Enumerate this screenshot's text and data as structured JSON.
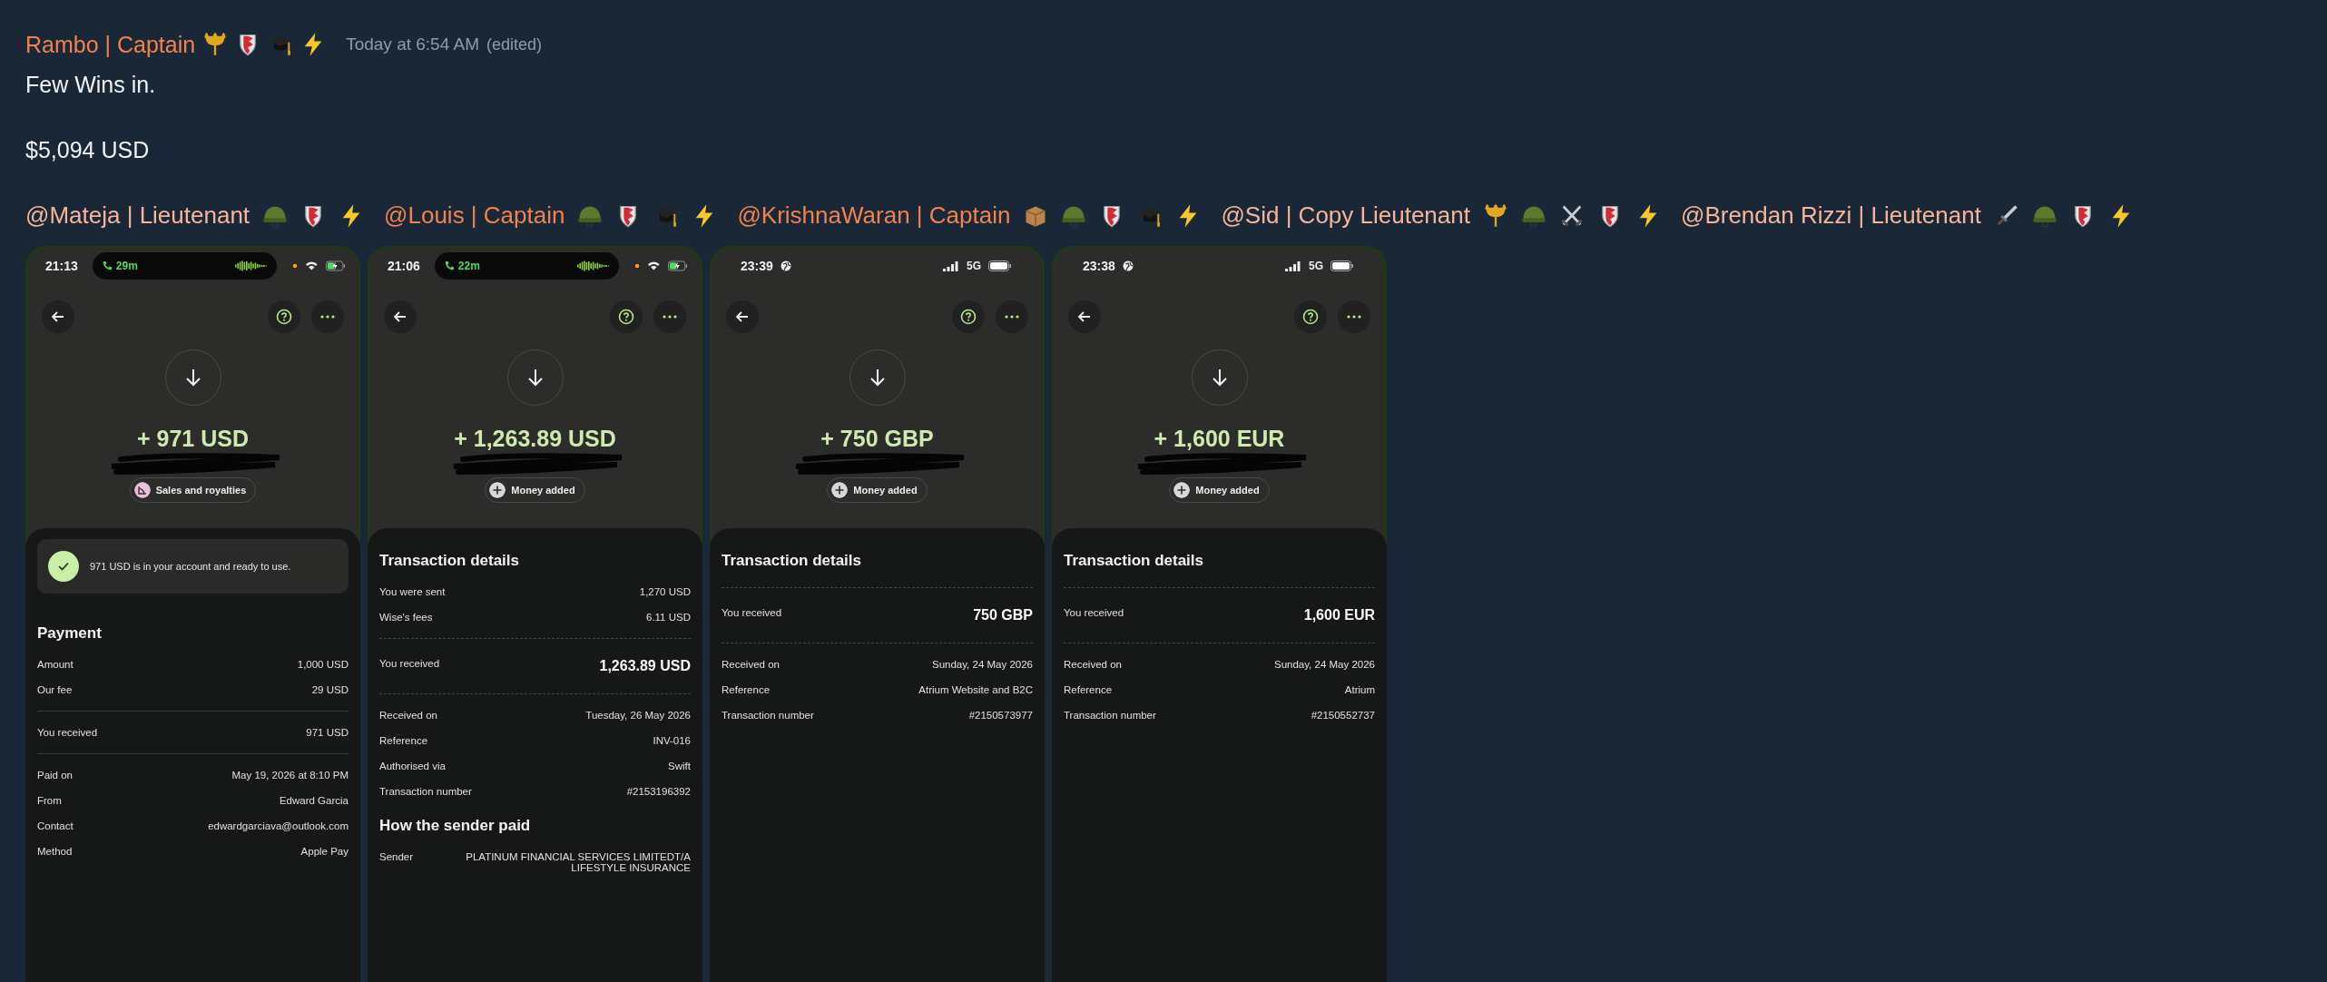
{
  "message": {
    "author": {
      "name": "Rambo | Captain",
      "color": "#f0834f",
      "badges": [
        {
          "kind": "trident"
        },
        {
          "kind": "shield"
        },
        {
          "kind": "cap"
        },
        {
          "kind": "bolt"
        }
      ]
    },
    "timestamp": "Today at 6:54 AM",
    "edited": "(edited)",
    "lines": [
      "Few Wins in.",
      "$5,094 USD"
    ],
    "mentions": [
      {
        "text": "@Mateja | Lieutenant",
        "color": "#f6b59a",
        "badges": [
          {
            "kind": "helmet"
          },
          {
            "kind": "shield"
          },
          {
            "kind": "bolt"
          }
        ]
      },
      {
        "text": "@Louis | Captain",
        "color": "#f0834f",
        "badges": [
          {
            "kind": "helmet"
          },
          {
            "kind": "shield"
          },
          {
            "kind": "cap"
          },
          {
            "kind": "bolt"
          }
        ]
      },
      {
        "text": "@KrishnaWaran | Captain",
        "color": "#f0834f",
        "badges": [
          {
            "kind": "box"
          },
          {
            "kind": "helmet"
          },
          {
            "kind": "shield"
          },
          {
            "kind": "cap"
          },
          {
            "kind": "bolt"
          }
        ]
      },
      {
        "text": "@Sid | Copy Lieutenant",
        "color": "#f6b59a",
        "badges": [
          {
            "kind": "trident"
          },
          {
            "kind": "helmet"
          },
          {
            "kind": "swords"
          },
          {
            "kind": "shield"
          },
          {
            "kind": "bolt"
          }
        ]
      },
      {
        "text": "@Brendan Rizzi | Lieutenant",
        "color": "#f6b59a",
        "badges": [
          {
            "kind": "dagger"
          },
          {
            "kind": "helmet"
          },
          {
            "kind": "shield"
          },
          {
            "kind": "bolt"
          }
        ]
      }
    ],
    "attachments": [
      {
        "status": {
          "kind": "call",
          "time": "21:13",
          "call_duration": "29m"
        },
        "amount": "+ 971 USD",
        "chip": {
          "kind": "sales",
          "label": "Sales and royalties"
        },
        "sheet": [
          {
            "kind": "notice",
            "text": "971 USD is in your account and ready to use."
          },
          {
            "kind": "heading",
            "text": "Payment"
          },
          {
            "kind": "row",
            "label": "Amount",
            "value": "1,000 USD"
          },
          {
            "kind": "row",
            "label": "Our fee",
            "value": "29 USD"
          },
          {
            "kind": "divider"
          },
          {
            "kind": "row",
            "label": "You received",
            "value": "971 USD"
          },
          {
            "kind": "divider"
          },
          {
            "kind": "row",
            "label": "Paid on",
            "value": "May 19, 2026 at 8:10 PM"
          },
          {
            "kind": "row",
            "label": "From",
            "value": "Edward Garcia"
          },
          {
            "kind": "row",
            "label": "Contact",
            "value": "edwardgarciava@outlook.com"
          },
          {
            "kind": "row",
            "label": "Method",
            "value": "Apple Pay"
          }
        ]
      },
      {
        "status": {
          "kind": "call",
          "time": "21:06",
          "call_duration": "22m"
        },
        "amount": "+ 1,263.89 USD",
        "chip": {
          "kind": "plus",
          "label": "Money added"
        },
        "sheet": [
          {
            "kind": "heading",
            "text": "Transaction details"
          },
          {
            "kind": "row",
            "label": "You were sent",
            "value": "1,270 USD"
          },
          {
            "kind": "row",
            "label": "Wise's fees",
            "value": "6.11 USD"
          },
          {
            "kind": "dashed-divider"
          },
          {
            "kind": "big-row",
            "label": "You received",
            "value": "1,263.89 USD"
          },
          {
            "kind": "dashed-divider"
          },
          {
            "kind": "row",
            "label": "Received on",
            "value": "Tuesday, 26 May 2026"
          },
          {
            "kind": "row",
            "label": "Reference",
            "value": "INV-016"
          },
          {
            "kind": "row",
            "label": "Authorised via",
            "value": "Swift"
          },
          {
            "kind": "row",
            "label": "Transaction number",
            "value": "#2153196392"
          },
          {
            "kind": "heading",
            "text": "How the sender paid"
          },
          {
            "kind": "row",
            "label": "Sender",
            "value": "PLATINUM FINANCIAL SERVICES LIMITEDT/A LIFESTYLE INSURANCE"
          }
        ]
      },
      {
        "status": {
          "kind": "plain",
          "time": "23:39",
          "network": "5G"
        },
        "amount": "+ 750 GBP",
        "chip": {
          "kind": "plus",
          "label": "Money added"
        },
        "sheet": [
          {
            "kind": "heading",
            "text": "Transaction details"
          },
          {
            "kind": "dashed-divider"
          },
          {
            "kind": "big-row",
            "label": "You received",
            "value": "750 GBP"
          },
          {
            "kind": "dashed-divider"
          },
          {
            "kind": "row",
            "label": "Received on",
            "value": "Sunday, 24 May 2026"
          },
          {
            "kind": "row",
            "label": "Reference",
            "value": "Atrium Website and B2C"
          },
          {
            "kind": "row",
            "label": "Transaction number",
            "value": "#2150573977"
          }
        ]
      },
      {
        "status": {
          "kind": "plain",
          "time": "23:38",
          "network": "5G"
        },
        "amount": "+ 1,600 EUR",
        "chip": {
          "kind": "plus",
          "label": "Money added"
        },
        "sheet": [
          {
            "kind": "heading",
            "text": "Transaction details"
          },
          {
            "kind": "dashed-divider"
          },
          {
            "kind": "big-row",
            "label": "You received",
            "value": "1,600 EUR"
          },
          {
            "kind": "dashed-divider"
          },
          {
            "kind": "row",
            "label": "Received on",
            "value": "Sunday, 24 May 2026"
          },
          {
            "kind": "row",
            "label": "Reference",
            "value": "Atrium"
          },
          {
            "kind": "row",
            "label": "Transaction number",
            "value": "#2150552737"
          }
        ]
      }
    ]
  }
}
